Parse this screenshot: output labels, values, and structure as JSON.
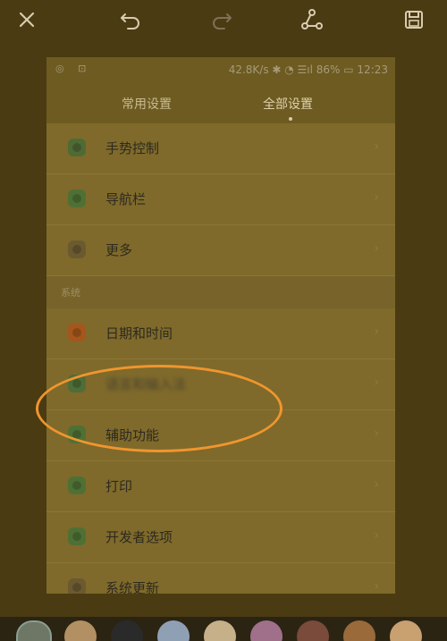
{
  "editor": {
    "tools": [
      {
        "name": "close-icon"
      },
      {
        "name": "undo-icon"
      },
      {
        "name": "redo-icon"
      },
      {
        "name": "share-icon"
      },
      {
        "name": "save-icon"
      }
    ]
  },
  "phone": {
    "status": {
      "left_icons": "◎ ⊡",
      "right": "42.8K/s ✱ ◔ ☰ıl 86% ▭ 12:23"
    },
    "tabs": {
      "common": "常用设置",
      "all": "全部设置"
    },
    "rows": [
      {
        "label": "手势控制",
        "icon": "gesture-icon",
        "color": "#4f6a34"
      },
      {
        "label": "导航栏",
        "icon": "navbar-icon",
        "color": "#4f7034"
      },
      {
        "label": "更多",
        "icon": "more-icon",
        "color": "#6b5a30"
      },
      {
        "label": "日期和时间",
        "icon": "clock-icon",
        "color": "#a4561d"
      },
      {
        "label": "语言和输入法",
        "icon": "language-icon",
        "color": "#4e6d38"
      },
      {
        "label": "辅助功能",
        "icon": "accessibility-icon",
        "color": "#4f7034"
      },
      {
        "label": "打印",
        "icon": "print-icon",
        "color": "#4f7034"
      },
      {
        "label": "开发者选项",
        "icon": "developer-icon",
        "color": "#4f7034"
      },
      {
        "label": "系统更新",
        "icon": "update-icon",
        "color": "#6b5a30"
      }
    ],
    "section_system": "系统",
    "chevron": "›"
  },
  "annotation": {
    "highlight_color": "#f0962d"
  },
  "filters": {
    "colors": [
      "#6e7766",
      "#b39063",
      "#2a2a2a",
      "#8fa0b4",
      "#c5b08a",
      "#a0708a",
      "#7a4a3a",
      "#9a6a3a",
      "#c9a070"
    ]
  }
}
